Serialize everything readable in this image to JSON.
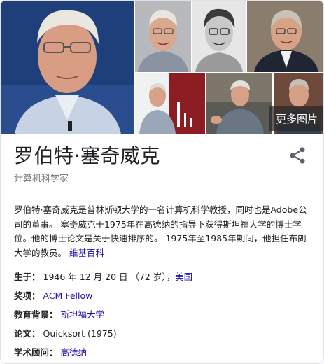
{
  "gallery": {
    "images": [
      {
        "name": "portrait-main"
      },
      {
        "name": "portrait-glasses-smiling"
      },
      {
        "name": "portrait-bw-sketch"
      },
      {
        "name": "portrait-suit"
      },
      {
        "name": "lecture-red-background"
      },
      {
        "name": "lecture-speaking"
      },
      {
        "name": "portrait-small"
      }
    ],
    "more_label": "更多图片"
  },
  "header": {
    "title": "罗伯特·塞奇威克",
    "subtitle": "计算机科学家",
    "share_icon": "share-icon"
  },
  "description": {
    "text": "罗伯特·塞奇威克是普林斯顿大学的一名计算机科学教授，同时也是Adobe公司的董事。 塞奇威克于1975年在高德纳的指导下获得斯坦福大学的博士学位。他的博士论文是关于快速排序的。 1975年至1985年期间，他担任布朗大学的教员。",
    "source_link": "维基百科"
  },
  "facts": [
    {
      "label": "生于：",
      "value": "1946 年 12 月 20 日 （72 岁），",
      "link": "美国"
    },
    {
      "label": "奖项：",
      "value": "",
      "link": "ACM Fellow"
    },
    {
      "label": "教育背景：",
      "value": "",
      "link": "斯坦福大学"
    },
    {
      "label": "论文：",
      "value": "Quicksort (1975)",
      "link": ""
    },
    {
      "label": "学术顾问：",
      "value": "",
      "link": "高德纳"
    }
  ],
  "colors": {
    "link": "#1a0dab",
    "subtitle": "#70757a",
    "title": "#202124"
  }
}
